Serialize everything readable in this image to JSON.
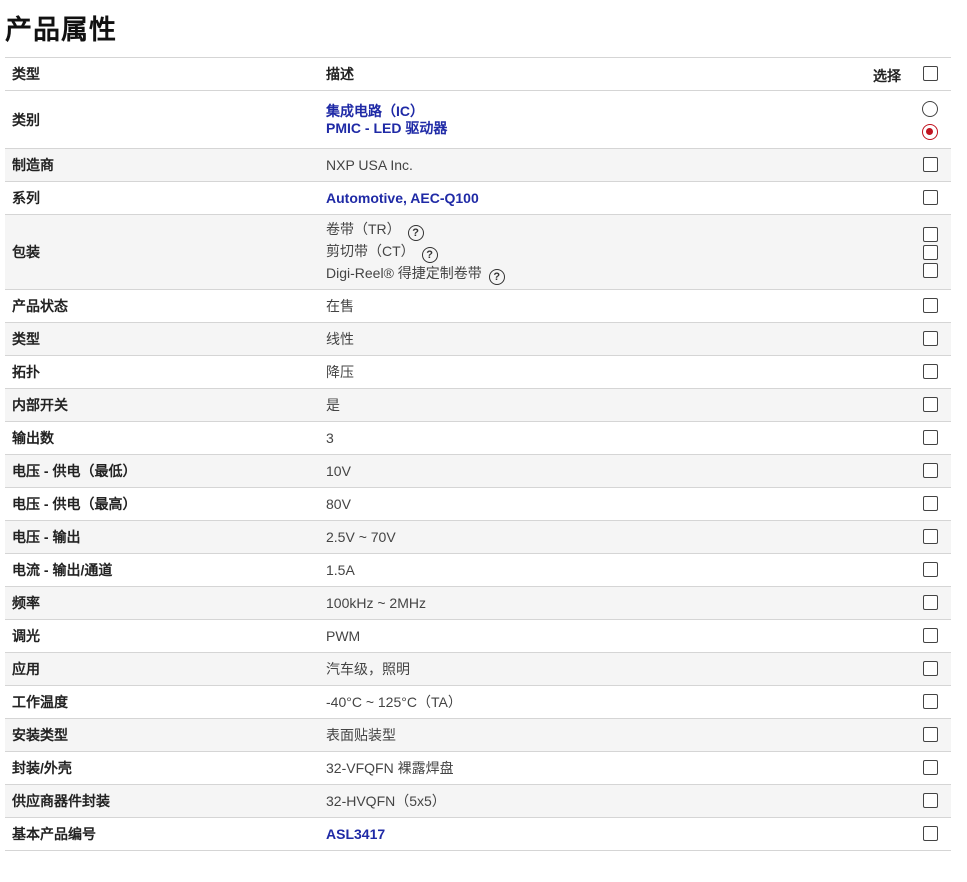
{
  "page_title": "产品属性",
  "header": {
    "type": "类型",
    "description": "描述",
    "select": "选择"
  },
  "rows": [
    {
      "name": "类别",
      "lines": [
        "集成电路（IC）",
        "PMIC - LED 驱动器"
      ],
      "link": true
    },
    {
      "name": "制造商",
      "value": "NXP USA Inc."
    },
    {
      "name": "系列",
      "value": "Automotive, AEC-Q100",
      "link": true
    },
    {
      "name": "包装",
      "options": [
        "卷带（TR）",
        "剪切带（CT）",
        "Digi-Reel® 得捷定制卷带"
      ]
    },
    {
      "name": "产品状态",
      "value": "在售"
    },
    {
      "name": "类型",
      "value": "线性"
    },
    {
      "name": "拓扑",
      "value": "降压"
    },
    {
      "name": "内部开关",
      "value": "是"
    },
    {
      "name": "输出数",
      "value": "3"
    },
    {
      "name": "电压 - 供电（最低）",
      "value": "10V"
    },
    {
      "name": "电压 - 供电（最高）",
      "value": "80V"
    },
    {
      "name": "电压 - 输出",
      "value": "2.5V ~ 70V"
    },
    {
      "name": "电流 - 输出/通道",
      "value": "1.5A"
    },
    {
      "name": "频率",
      "value": "100kHz ~ 2MHz"
    },
    {
      "name": "调光",
      "value": "PWM"
    },
    {
      "name": "应用",
      "value": "汽车级，照明"
    },
    {
      "name": "工作温度",
      "value": "-40°C ~ 125°C（TA）"
    },
    {
      "name": "安装类型",
      "value": "表面贴装型"
    },
    {
      "name": "封装/外壳",
      "value": "32-VFQFN 裸露焊盘"
    },
    {
      "name": "供应商器件封装",
      "value": "32-HVQFN（5x5）"
    },
    {
      "name": "基本产品编号",
      "value": "ASL3417",
      "link": true
    }
  ],
  "help_icon_glyph": "?",
  "colors": {
    "link": "#1f2aa6",
    "radio_selected": "#c1121f",
    "stripe": "#f5f5f5"
  }
}
